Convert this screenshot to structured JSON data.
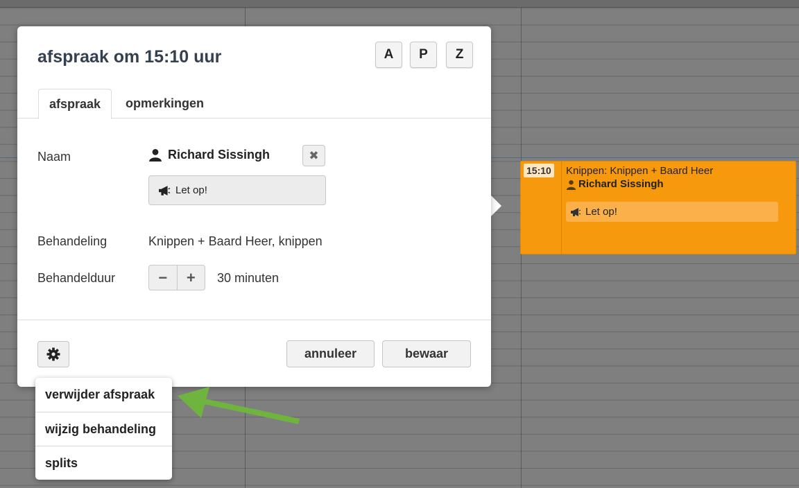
{
  "modal": {
    "title": "afspraak om 15:10 uur",
    "key_buttons": [
      "A",
      "P",
      "Z"
    ],
    "tabs": [
      {
        "label": "afspraak",
        "active": true
      },
      {
        "label": "opmerkingen",
        "active": false
      }
    ],
    "fields": {
      "name_label": "Naam",
      "name_value": "Richard Sissingh",
      "note": "Let op!",
      "treatment_label": "Behandeling",
      "treatment_value": "Knippen + Baard Heer, knippen",
      "duration_label": "Behandelduur",
      "duration_value": "30 minuten",
      "minus": "−",
      "plus": "+"
    },
    "footer": {
      "cancel": "annuleer",
      "save": "bewaar"
    }
  },
  "menu": {
    "items": [
      "verwijder afspraak",
      "wijzig behandeling",
      "splits"
    ]
  },
  "appointment": {
    "time": "15:10",
    "treatment": "Knippen:  Knippen + Baard Heer",
    "client": "Richard Sissingh",
    "note": "Let op!",
    "color": "#f7990c"
  },
  "annotation": {
    "arrow_color": "#6fb43f"
  }
}
